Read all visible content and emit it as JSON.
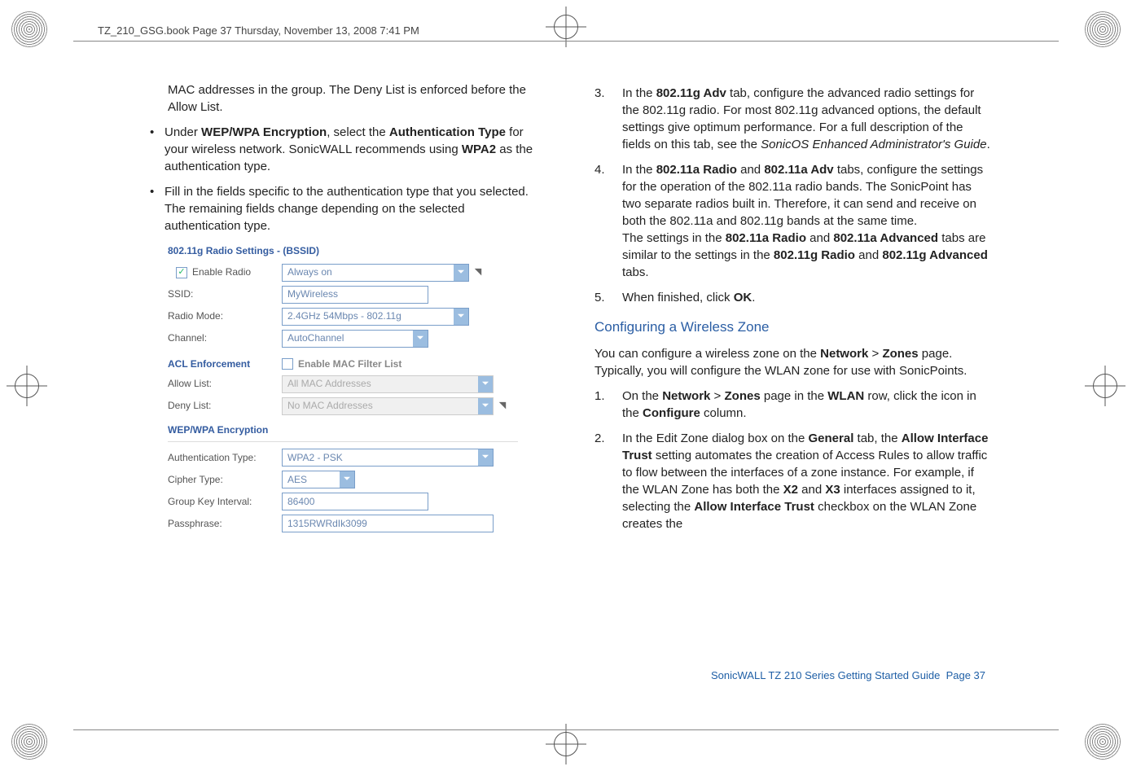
{
  "head_note": "TZ_210_GSG.book  Page 37  Thursday, November 13, 2008  7:41 PM",
  "left": {
    "hang_intro": "MAC addresses in the group. The Deny List is enforced before the Allow List.",
    "bullets": [
      {
        "pre": "Under ",
        "b1": "WEP/WPA Encryption",
        "mid": ", select the ",
        "b2": "Authentication Type",
        "post": " for your wireless network. SonicWALL recommends using ",
        "b3": "WPA2",
        "tail": " as the authentication type."
      },
      {
        "text": "Fill in the fields specific to the authentication type that you selected. The remaining fields change depending on the selected authentication type."
      }
    ],
    "screenshot": {
      "section1_title": "802.11g Radio Settings - (BSSID)",
      "enable_radio_label": "Enable Radio",
      "enable_radio_checked": true,
      "schedule_value": "Always on",
      "ssid_label": "SSID:",
      "ssid_value": "MyWireless",
      "radio_mode_label": "Radio Mode:",
      "radio_mode_value": "2.4GHz 54Mbps - 802.11g",
      "channel_label": "Channel:",
      "channel_value": "AutoChannel",
      "acl_title": "ACL Enforcement",
      "enable_mac_label": "Enable MAC Filter List",
      "enable_mac_checked": false,
      "allow_list_label": "Allow List:",
      "allow_list_value": "All MAC Addresses",
      "deny_list_label": "Deny List:",
      "deny_list_value": "No MAC Addresses",
      "wep_title": "WEP/WPA Encryption",
      "auth_type_label": "Authentication Type:",
      "auth_type_value": "WPA2 - PSK",
      "cipher_label": "Cipher Type:",
      "cipher_value": "AES",
      "gki_label": "Group Key Interval:",
      "gki_value": "86400",
      "pass_label": "Passphrase:",
      "pass_value": "1315RWRdIk3099"
    }
  },
  "right": {
    "steps_a": [
      {
        "num": "3.",
        "text_pre": "In the ",
        "b1": "802.11g Adv",
        "text_mid": " tab, configure the advanced radio settings for the 802.11g radio. For most 802.11g advanced options, the default settings give optimum performance. For a full description of the fields on this tab, see the ",
        "i1": "SonicOS Enhanced Administrator's Guide",
        "text_post": "."
      },
      {
        "num": "4.",
        "p1_pre": "In the ",
        "p1_b1": "802.11a Radio",
        "p1_mid": " and ",
        "p1_b2": "802.11a Adv",
        "p1_post": " tabs, configure the settings for the operation of the 802.11a radio bands. The SonicPoint has two separate radios built in. Therefore, it can send and receive on both the 802.11a and 802.11g bands at the same time.",
        "p2_pre": "The settings in the ",
        "p2_b1": "802.11a Radio",
        "p2_mid": " and ",
        "p2_b2": "802.11a Advanced",
        "p2_mid2": " tabs are similar to the settings in the ",
        "p2_b3": "802.11g Radio",
        "p2_mid3": " and ",
        "p2_b4": "802.11g Advanced",
        "p2_post": " tabs."
      },
      {
        "num": "5.",
        "pre": "When finished, click ",
        "b1": "OK",
        "post": "."
      }
    ],
    "subhead": "Configuring a Wireless Zone",
    "sub_intro_pre": "You can configure a wireless zone on the ",
    "sub_intro_b1": "Network",
    "sub_intro_gt": " > ",
    "sub_intro_b2": "Zones",
    "sub_intro_post": " page. Typically, you will configure the WLAN zone for use with SonicPoints.",
    "steps_b": [
      {
        "num": "1.",
        "pre": "On the ",
        "b1": "Network",
        "gt": " > ",
        "b2": "Zones",
        "mid": " page in the ",
        "b3": "WLAN",
        "mid2": " row, click the icon in the ",
        "b4": "Configure",
        "post": " column."
      },
      {
        "num": "2.",
        "pre": "In the Edit Zone dialog box on the ",
        "b1": "General",
        "mid": " tab, the ",
        "b2": "Allow Interface Trust",
        "mid2": " setting automates the creation of Access Rules to allow traffic to flow between the interfaces of a zone instance. For example, if the WLAN Zone has both the ",
        "b3": "X2",
        "mid3": " and ",
        "b4": "X3",
        "mid4": " interfaces assigned to it, selecting the ",
        "b5": "Allow Interface Trust",
        "post": " checkbox on the WLAN Zone creates the"
      }
    ]
  },
  "footer_text": "SonicWALL TZ 210 Series Getting Started Guide",
  "footer_page": "Page 37"
}
